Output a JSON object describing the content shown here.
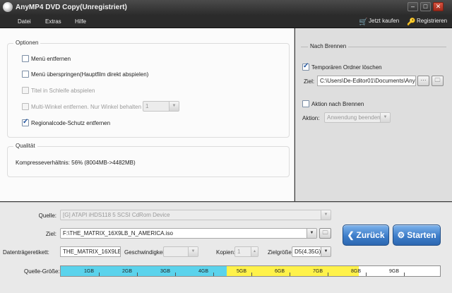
{
  "window": {
    "title": "AnyMP4 DVD Copy(Unregistriert)",
    "controls": [
      "–",
      "□",
      "✕"
    ]
  },
  "menu": {
    "items": [
      "Datei",
      "Extras",
      "Hilfe"
    ],
    "buy_label": "Jetzt kaufen",
    "register_label": "Registrieren"
  },
  "options": {
    "title": "Optionen",
    "items": [
      {
        "label": "Menü entfernen",
        "checked": false,
        "enabled": true
      },
      {
        "label": "Menü überspringen(Hauptfilm direkt abspielen)",
        "checked": false,
        "enabled": true
      },
      {
        "label": "Titel in Schleife abspielen",
        "checked": false,
        "enabled": false
      },
      {
        "label": "Multi-Winkel entfernen. Nur Winkel behalten",
        "checked": false,
        "enabled": false
      },
      {
        "label": "Regionalcode-Schutz entfernen",
        "checked": true,
        "enabled": true
      }
    ],
    "angle_value": "1"
  },
  "quality": {
    "title": "Qualität",
    "text": "Kompresseverhältnis:  56%  (8004MB->4482MB)"
  },
  "after_burn": {
    "title": "Nach Brennen",
    "delete_temp_label": "Temporären Ordner löschen",
    "delete_temp_checked": true,
    "target_label": "Ziel:",
    "target_value": "C:\\Users\\De-Editor01\\Documents\\AnyMP4",
    "browse_label": "···",
    "action_after_label": "Aktion nach Brennen",
    "action_after_checked": false,
    "action_label": "Aktion:",
    "action_value": "Anwendung beenden"
  },
  "bottom": {
    "source_label": "Quelle:",
    "source_value": "[G] ATAPI iHDS118   5 SCSI CdRom Device",
    "target_label": "Ziel:",
    "target_value": "F:\\THE_MATRIX_16X9LB_N_AMERICA.iso",
    "disc_label_label": "Datenträgeretikett:",
    "disc_label_value": "THE_MATRIX_16X9LB_N",
    "speed_label": "Geschwindigkeit:",
    "speed_value": "",
    "copies_label": "Kopien:",
    "copies_value": "1",
    "target_size_label": "Zielgröße:",
    "target_size_value": "D5(4.35G)",
    "back_label": "Zurück",
    "start_label": "Starten",
    "source_size_label": "Quelle-Größe:"
  },
  "size_bar": {
    "ticks": [
      "1GB",
      "2GB",
      "3GB",
      "4GB",
      "5GB",
      "6GB",
      "7GB",
      "8GB",
      "9GB"
    ],
    "cyan_end_gb": 4.35,
    "yellow_end_gb": 7.82,
    "colors": {
      "fit": "#5bd3ec",
      "over": "#fff24a",
      "empty": "#ffffff"
    }
  },
  "colors": {
    "accent": "#3d7dc9",
    "titlebar": "#3a3a3a"
  }
}
